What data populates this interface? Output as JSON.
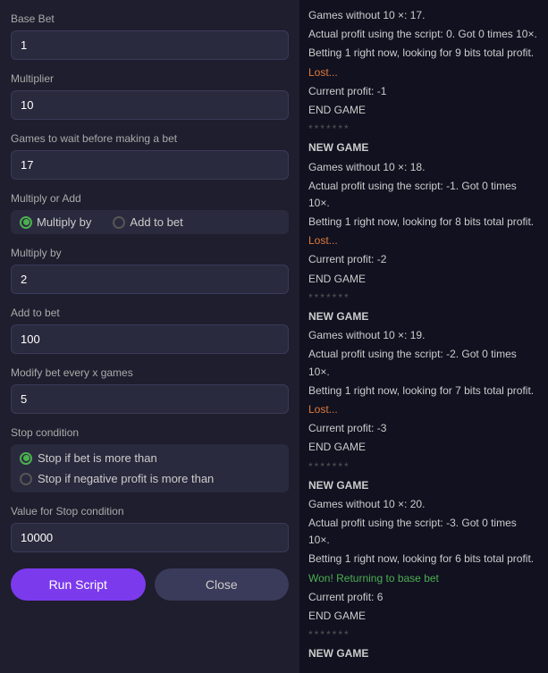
{
  "left": {
    "base_bet_label": "Base Bet",
    "base_bet_value": "1",
    "multiplier_label": "Multiplier",
    "multiplier_value": "10",
    "games_wait_label": "Games to wait before making a bet",
    "games_wait_value": "17",
    "multiply_or_add_label": "Multiply or Add",
    "radio_multiply": "Multiply by",
    "radio_add": "Add to bet",
    "multiply_by_label": "Multiply by",
    "multiply_by_value": "2",
    "add_to_bet_label": "Add to bet",
    "add_to_bet_value": "100",
    "modify_bet_label": "Modify bet every x games",
    "modify_bet_value": "5",
    "stop_condition_label": "Stop condition",
    "stop_if_bet_label": "Stop if bet is more than",
    "stop_if_negative_label": "Stop if negative profit is more than",
    "value_stop_label": "Value for Stop condition",
    "value_stop_value": "10000",
    "btn_run": "Run Script",
    "btn_close": "Close"
  },
  "log": [
    {
      "type": "normal",
      "text": "Games without 10 ×: 17."
    },
    {
      "type": "normal",
      "text": "Actual profit using the script: 0. Got 0 times 10×."
    },
    {
      "type": "normal",
      "text": "Betting 1 right now, looking for 9 bits total profit."
    },
    {
      "type": "lost",
      "text": "Lost..."
    },
    {
      "type": "normal",
      "text": "Current profit: -1"
    },
    {
      "type": "end",
      "text": "END GAME"
    },
    {
      "type": "sep",
      "text": "*******"
    },
    {
      "type": "new",
      "text": "NEW GAME"
    },
    {
      "type": "normal",
      "text": "Games without 10 ×: 18."
    },
    {
      "type": "normal",
      "text": "Actual profit using the script: -1. Got 0 times 10×."
    },
    {
      "type": "normal",
      "text": "Betting 1 right now, looking for 8 bits total profit."
    },
    {
      "type": "lost",
      "text": "Lost..."
    },
    {
      "type": "normal",
      "text": "Current profit: -2"
    },
    {
      "type": "end",
      "text": "END GAME"
    },
    {
      "type": "sep",
      "text": "*******"
    },
    {
      "type": "new",
      "text": "NEW GAME"
    },
    {
      "type": "normal",
      "text": "Games without 10 ×: 19."
    },
    {
      "type": "normal",
      "text": "Actual profit using the script: -2. Got 0 times 10×."
    },
    {
      "type": "normal",
      "text": "Betting 1 right now, looking for 7 bits total profit."
    },
    {
      "type": "lost",
      "text": "Lost..."
    },
    {
      "type": "normal",
      "text": "Current profit: -3"
    },
    {
      "type": "end",
      "text": "END GAME"
    },
    {
      "type": "sep",
      "text": "*******"
    },
    {
      "type": "new",
      "text": "NEW GAME"
    },
    {
      "type": "normal",
      "text": "Games without 10 ×: 20."
    },
    {
      "type": "normal",
      "text": "Actual profit using the script: -3. Got 0 times 10×."
    },
    {
      "type": "normal",
      "text": "Betting 1 right now, looking for 6 bits total profit."
    },
    {
      "type": "win",
      "text": "Won! Returning to base bet"
    },
    {
      "type": "normal",
      "text": "Current profit: 6"
    },
    {
      "type": "end",
      "text": "END GAME"
    },
    {
      "type": "sep",
      "text": "*******"
    },
    {
      "type": "new",
      "text": "NEW GAME"
    }
  ]
}
